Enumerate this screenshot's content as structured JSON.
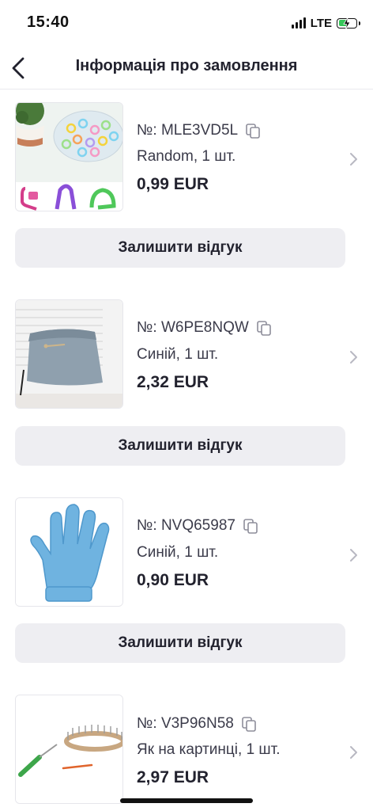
{
  "status_bar": {
    "time": "15:40",
    "network": "LTE",
    "battery_level": 0.55
  },
  "header": {
    "title": "Інформація про замовлення",
    "back_icon": "chevron-left-icon"
  },
  "items": [
    {
      "order_number": "№: MLE3VD5L",
      "variant": "Random, 1 шт.",
      "price": "0,99 EUR",
      "review_label": "Залишити відгук",
      "image": "colorful-stitch-markers"
    },
    {
      "order_number": "№: W6PE8NQW",
      "variant": "Синій, 1 шт.",
      "price": "2,32 EUR",
      "review_label": "Залишити відгук",
      "image": "blue-cosmetic-bag"
    },
    {
      "order_number": "№: NVQ65987",
      "variant": "Синій, 1 шт.",
      "price": "0,90 EUR",
      "review_label": "Залишити відгук",
      "image": "blue-exfoliating-glove"
    },
    {
      "order_number": "№: V3P96N58",
      "variant": "Як на картинці, 1 шт.",
      "price": "2,97 EUR",
      "image": "knitting-loom-and-hook"
    }
  ],
  "colors": {
    "accent_text": "#22222e",
    "button_bg": "#eeeef2",
    "battery": "#35c759"
  }
}
